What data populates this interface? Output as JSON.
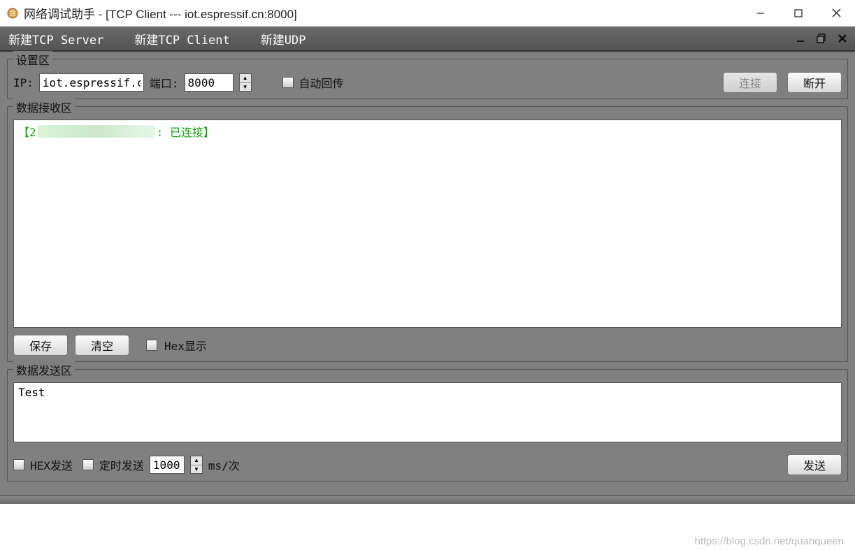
{
  "window": {
    "title": "网络调试助手 - [TCP Client --- iot.espressif.cn:8000]"
  },
  "menu": {
    "new_tcp_server": "新建TCP Server",
    "new_tcp_client": "新建TCP Client",
    "new_udp": "新建UDP"
  },
  "settings": {
    "legend": "设置区",
    "ip_label": "IP:",
    "ip_value": "iot.espressif.cn",
    "port_label": "端口:",
    "port_value": "8000",
    "auto_return": "自动回传",
    "connect": "连接",
    "disconnect": "断开"
  },
  "receive": {
    "legend": "数据接收区",
    "message_prefix": "【2",
    "message_suffix": ": 已连接】",
    "save": "保存",
    "clear": "清空",
    "hex_display": "Hex显示"
  },
  "send": {
    "legend": "数据发送区",
    "content": "Test",
    "hex_send": "HEX发送",
    "timed_send": "定时发送",
    "interval_value": "1000",
    "interval_unit": "ms/次",
    "send_btn": "发送"
  },
  "watermark": "https://blog.csdn.net/quanqueen"
}
